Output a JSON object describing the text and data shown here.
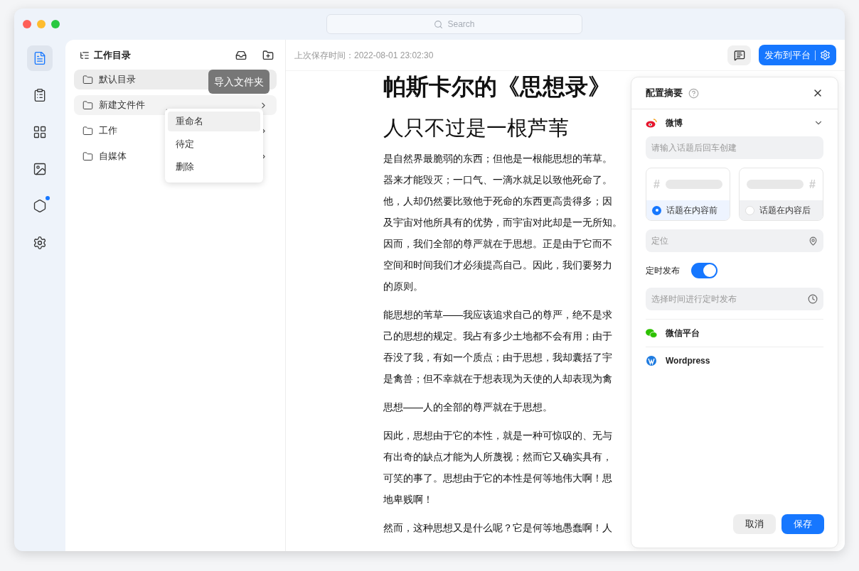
{
  "window": {
    "search_placeholder": "Search"
  },
  "rail": [
    {
      "kind": "doc",
      "selected": true,
      "badge": false
    },
    {
      "kind": "clipboard",
      "selected": false,
      "badge": false
    },
    {
      "kind": "grid",
      "selected": false,
      "badge": false
    },
    {
      "kind": "image",
      "selected": false,
      "badge": false
    },
    {
      "kind": "hexagon",
      "selected": false,
      "badge": true
    },
    {
      "kind": "settings",
      "selected": false,
      "badge": false
    }
  ],
  "folders": {
    "title": "工作目录",
    "tooltip": "导入文件夹",
    "items": [
      {
        "label": "默认目录",
        "selected": true,
        "hovered": false,
        "arrow": false
      },
      {
        "label": "新建文件件",
        "selected": false,
        "hovered": true,
        "arrow": true
      },
      {
        "label": "工作",
        "selected": false,
        "hovered": false,
        "arrow": true
      },
      {
        "label": "自媒体",
        "selected": false,
        "hovered": false,
        "arrow": true
      }
    ],
    "context_menu": [
      {
        "label": "重命名",
        "selected": true
      },
      {
        "label": "待定",
        "selected": false
      },
      {
        "label": "删除",
        "selected": false
      }
    ]
  },
  "editor": {
    "saved_time": "上次保存时间：2022-08-01 23:02:30",
    "publish_button": "发布到平台",
    "title": "帕斯卡尔的《思想录》",
    "heading": "人只不过是一根芦苇",
    "paragraphs": [
      [
        "是自然界最脆弱的东西；但他是一根能思想的苇草。",
        "器来才能毁灭；一口气、一滴水就足以致他死命了。",
        "他，人却仍然要比致他于死命的东西更高贵得多；因",
        "及宇宙对他所具有的优势，而宇宙对此却是一无所知。",
        "因而，我们全部的尊严就在于思想。正是由于它而不",
        "空间和时间我们才必须提高自己。因此，我们要努力",
        "的原则。"
      ],
      [
        "能思想的苇草——我应该追求自己的尊严，绝不是求",
        "己的思想的规定。我占有多少土地都不会有用；由于",
        "吞没了我，有如一个质点；由于思想，我却囊括了宇",
        "是禽兽；但不幸就在于想表现为天使的人却表现为禽"
      ],
      [
        "思想——人的全部的尊严就在于思想。"
      ],
      [
        "因此，思想由于它的本性，就是一种可惊叹的、无与",
        "有出奇的缺点才能为人所蔑视；然而它又确实具有，",
        "可笑的事了。思想由于它的本性是何等地伟大啊！思",
        "地卑贱啊！"
      ],
      [
        "然而，这种思想又是什么呢？它是何等地愚蠢啊！人"
      ]
    ]
  },
  "config": {
    "title": "配置摘要",
    "platforms": [
      {
        "kind": "weibo",
        "name": "微博",
        "expanded": true
      },
      {
        "kind": "wechat",
        "name": "微信平台",
        "expanded": false
      },
      {
        "kind": "wordpress",
        "name": "Wordpress",
        "expanded": false
      }
    ],
    "topic_placeholder": "请输入话题后回车创建",
    "positions": [
      {
        "label": "话题在内容前",
        "mark": "#",
        "selected": true
      },
      {
        "label": "话题在内容后",
        "mark": "#",
        "selected": false
      }
    ],
    "location_placeholder": "定位",
    "schedule_label": "定时发布",
    "schedule_on": true,
    "time_placeholder": "选择时间进行定时发布",
    "cancel": "取消",
    "save": "保存"
  }
}
